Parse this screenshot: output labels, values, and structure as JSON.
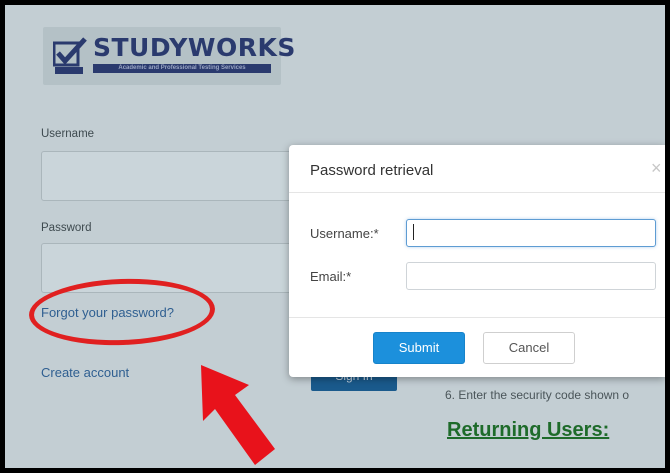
{
  "logo": {
    "name": "STUDYWORKS",
    "tagline": "Academic and Professional Testing Services"
  },
  "login": {
    "username_label": "Username",
    "password_label": "Password",
    "forgot_link": "Forgot your password?",
    "create_link": "Create account",
    "signin_button": "Sign In"
  },
  "instructions": {
    "step6": "6. Enter the security code shown o",
    "returning_heading": "Returning Users:"
  },
  "modal": {
    "title": "Password retrieval",
    "close_glyph": "×",
    "username_label": "Username:*",
    "username_value": "",
    "email_label": "Email:*",
    "email_value": "",
    "submit_label": "Submit",
    "cancel_label": "Cancel"
  },
  "annotations": {
    "ring_color": "#e02020",
    "arrow_color": "#e8121b"
  }
}
